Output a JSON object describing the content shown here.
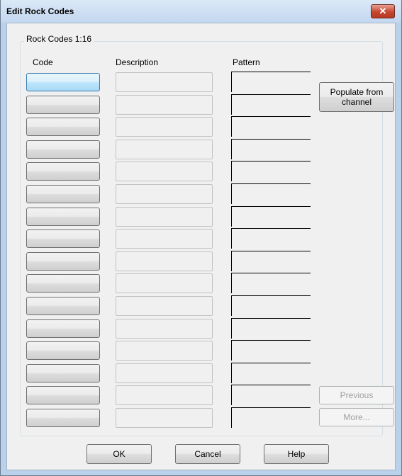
{
  "window": {
    "title": "Edit Rock Codes",
    "close_glyph": "✕"
  },
  "group": {
    "label": "Rock Codes 1:16"
  },
  "headers": {
    "code": "Code",
    "description": "Description",
    "pattern": "Pattern"
  },
  "rows": [
    {
      "code": "",
      "description": ""
    },
    {
      "code": "",
      "description": ""
    },
    {
      "code": "",
      "description": ""
    },
    {
      "code": "",
      "description": ""
    },
    {
      "code": "",
      "description": ""
    },
    {
      "code": "",
      "description": ""
    },
    {
      "code": "",
      "description": ""
    },
    {
      "code": "",
      "description": ""
    },
    {
      "code": "",
      "description": ""
    },
    {
      "code": "",
      "description": ""
    },
    {
      "code": "",
      "description": ""
    },
    {
      "code": "",
      "description": ""
    },
    {
      "code": "",
      "description": ""
    },
    {
      "code": "",
      "description": ""
    },
    {
      "code": "",
      "description": ""
    },
    {
      "code": "",
      "description": ""
    }
  ],
  "buttons": {
    "populate": "Populate from channel",
    "previous": "Previous",
    "more": "More...",
    "ok": "OK",
    "cancel": "Cancel",
    "help": "Help"
  }
}
